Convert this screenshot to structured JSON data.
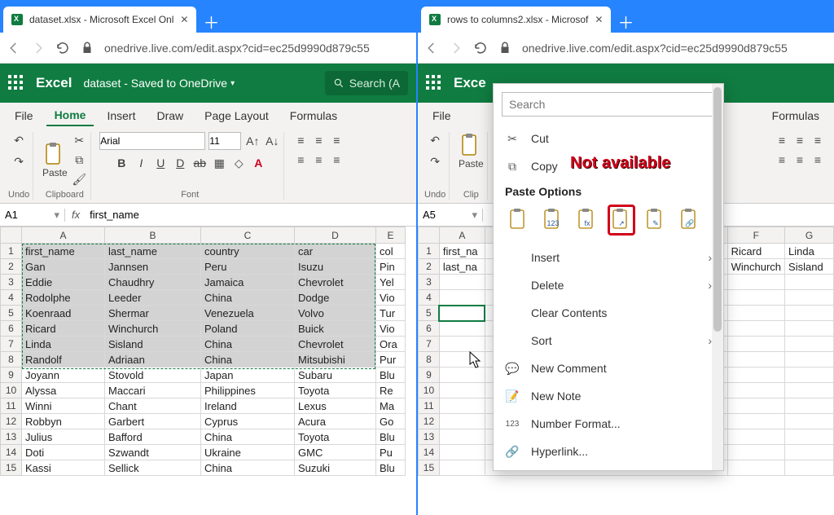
{
  "left": {
    "tab_title": "dataset.xlsx - Microsoft Excel Onl",
    "url": "onedrive.live.com/edit.aspx?cid=ec25d9990d879c55",
    "app": "Excel",
    "filename_status": "dataset  - Saved to OneDrive",
    "search_placeholder": "Search (A",
    "ribbon": {
      "file": "File",
      "home": "Home",
      "insert": "Insert",
      "draw": "Draw",
      "page": "Page Layout",
      "formulas": "Formulas"
    },
    "groups": {
      "undo": "Undo",
      "clipboard": "Clipboard",
      "font": "Font",
      "paste": "Paste"
    },
    "font_name": "Arial",
    "font_size": "11",
    "activecell": "A1",
    "formula_value": "first_name",
    "col_headers": [
      "A",
      "B",
      "C",
      "D",
      "E"
    ],
    "row_headers": [
      "1",
      "2",
      "3",
      "4",
      "5",
      "6",
      "7",
      "8",
      "9",
      "10",
      "11",
      "12",
      "13",
      "14",
      "15"
    ],
    "rows": [
      [
        "first_name",
        "last_name",
        "country",
        "car",
        "col"
      ],
      [
        "Gan",
        "Jannsen",
        "Peru",
        "Isuzu",
        "Pin"
      ],
      [
        "Eddie",
        "Chaudhry",
        "Jamaica",
        "Chevrolet",
        "Yel"
      ],
      [
        "Rodolphe",
        "Leeder",
        "China",
        "Dodge",
        "Vio"
      ],
      [
        "Koenraad",
        "Shermar",
        "Venezuela",
        "Volvo",
        "Tur"
      ],
      [
        "Ricard",
        "Winchurch",
        "Poland",
        "Buick",
        "Vio"
      ],
      [
        "Linda",
        "Sisland",
        "China",
        "Chevrolet",
        "Ora"
      ],
      [
        "Randolf",
        "Adriaan",
        "China",
        "Mitsubishi",
        "Pur"
      ],
      [
        "Joyann",
        "Stovold",
        "Japan",
        "Subaru",
        "Blu"
      ],
      [
        "Alyssa",
        "Maccari",
        "Philippines",
        "Toyota",
        "Re"
      ],
      [
        "Winni",
        "Chant",
        "Ireland",
        "Lexus",
        "Ma"
      ],
      [
        "Robbyn",
        "Garbert",
        "Cyprus",
        "Acura",
        "Go"
      ],
      [
        "Julius",
        "Bafford",
        "China",
        "Toyota",
        "Blu"
      ],
      [
        "Doti",
        "Szwandt",
        "Ukraine",
        "GMC",
        "Pu"
      ],
      [
        "Kassi",
        "Sellick",
        "China",
        "Suzuki",
        "Blu"
      ]
    ],
    "selection": {
      "r1": 1,
      "c1": 1,
      "r2": 8,
      "c2": 4
    }
  },
  "right": {
    "tab_title": "rows to columns2.xlsx - Microsof",
    "url": "onedrive.live.com/edit.aspx?cid=ec25d9990d879c55",
    "app": "Exce",
    "ribbon": {
      "file": "File",
      "formulas": "Formulas"
    },
    "groups": {
      "undo": "Undo",
      "clip": "Clip"
    },
    "activecell": "A5",
    "col_headers_vis": [
      "A",
      "F",
      "G"
    ],
    "row_headers": [
      "1",
      "2",
      "3",
      "4",
      "5",
      "6",
      "7",
      "8",
      "9",
      "10",
      "11",
      "12",
      "13",
      "14",
      "15"
    ],
    "colA_vals": [
      "first_na",
      "last_na",
      "",
      "",
      "",
      "",
      "",
      "",
      "",
      "",
      "",
      "",
      "",
      "",
      ""
    ],
    "colF_vals": [
      "Ricard",
      "Winchurch",
      "",
      "",
      "",
      "",
      "",
      "",
      "",
      "",
      "",
      "",
      "",
      "",
      ""
    ],
    "colG_vals": [
      "Linda",
      "Sisland",
      "",
      "",
      "",
      "",
      "",
      "",
      "",
      "",
      "",
      "",
      "",
      "",
      ""
    ]
  },
  "context_menu": {
    "search_placeholder": "Search",
    "cut": "Cut",
    "copy": "Copy",
    "paste_options": "Paste Options",
    "insert": "Insert",
    "delete": "Delete",
    "clear": "Clear Contents",
    "sort": "Sort",
    "new_comment": "New Comment",
    "new_note": "New Note",
    "number_format": "Number Format...",
    "hyperlink": "Hyperlink...",
    "paste_icons": [
      "paste",
      "paste-values",
      "paste-formulas",
      "paste-transpose",
      "paste-formatting",
      "paste-link"
    ]
  },
  "annotation": "Not available"
}
